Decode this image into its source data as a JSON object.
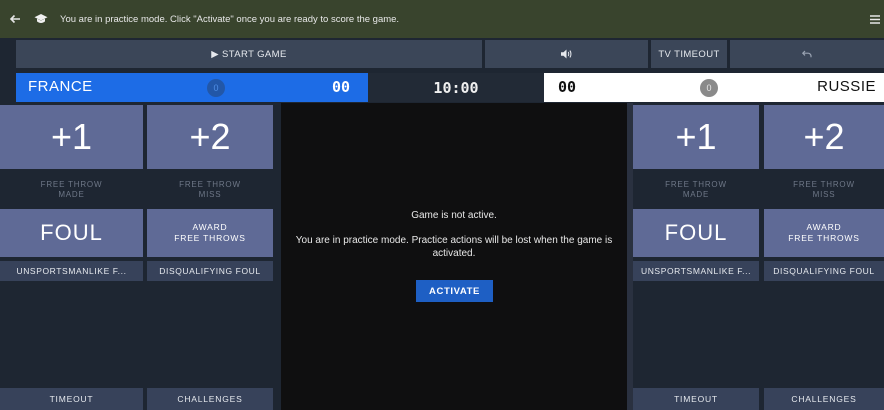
{
  "banner": {
    "back_icon": "arrow-left-icon",
    "mode_icon": "graduation-cap-icon",
    "message": "You are in practice mode. Click \"Activate\" once you are ready to score the game.",
    "menu_icon": "hamburger-menu-icon"
  },
  "controls": {
    "start_game": "▶ START GAME",
    "sound_icon": "volume-icon",
    "tv_timeout": "TV TIMEOUT",
    "undo_icon": "undo-icon"
  },
  "score": {
    "home_name": "FRANCE",
    "home_fouls": "0",
    "home_points": "00",
    "clock": "10:00",
    "away_points": "00",
    "away_fouls": "0",
    "away_name": "RUSSIE"
  },
  "colors": {
    "home": "#1d6ce6",
    "away": "#ffffff",
    "action": "#5f6a96",
    "activate": "#1e5fc4",
    "banner": "#39442d"
  },
  "left_panel": {
    "plus1": "+1",
    "plus2": "+2",
    "ft_made_1": "FREE THROW",
    "ft_made_2": "MADE",
    "ft_miss_1": "FREE THROW",
    "ft_miss_2": "MISS",
    "foul": "FOUL",
    "award_1": "AWARD",
    "award_2": "FREE THROWS",
    "unsportsmanlike": "UNSPORTSMANLIKE F...",
    "disqualifying": "DISQUALIFYING FOUL",
    "timeout": "TIMEOUT",
    "challenges": "CHALLENGES"
  },
  "right_panel": {
    "plus1": "+1",
    "plus2": "+2",
    "ft_made_1": "FREE THROW",
    "ft_made_2": "MADE",
    "ft_miss_1": "FREE THROW",
    "ft_miss_2": "MISS",
    "foul": "FOUL",
    "award_1": "AWARD",
    "award_2": "FREE THROWS",
    "unsportsmanlike": "UNSPORTSMANLIKE F...",
    "disqualifying": "DISQUALIFYING FOUL",
    "timeout": "TIMEOUT",
    "challenges": "CHALLENGES"
  },
  "center": {
    "status": "Game is not active.",
    "practice_message": "You are in practice mode. Practice actions will be lost when the game is activated.",
    "activate": "ACTIVATE"
  }
}
